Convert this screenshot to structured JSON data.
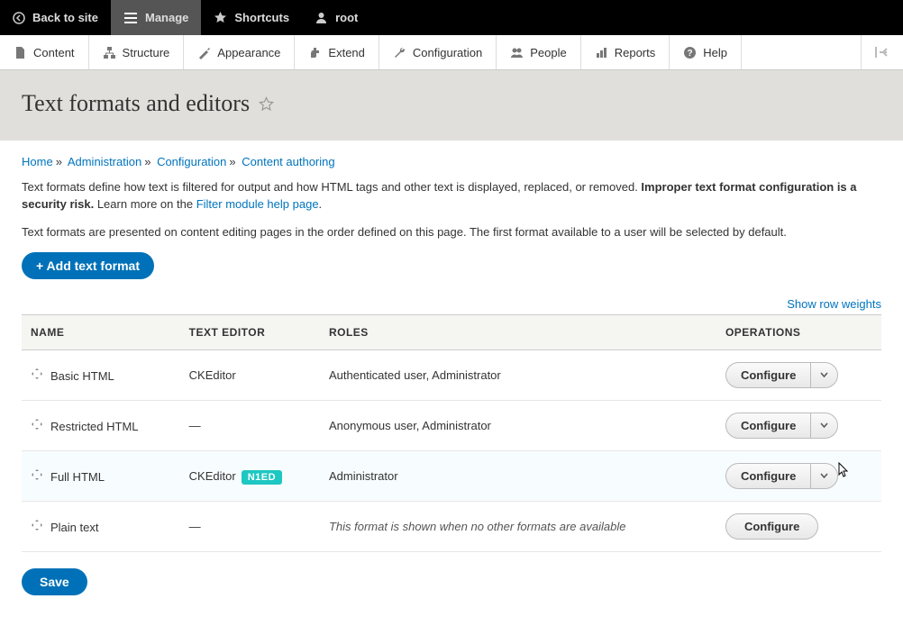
{
  "topbar": {
    "back": "Back to site",
    "manage": "Manage",
    "shortcuts": "Shortcuts",
    "user": "root"
  },
  "menubar": {
    "content": "Content",
    "structure": "Structure",
    "appearance": "Appearance",
    "extend": "Extend",
    "configuration": "Configuration",
    "people": "People",
    "reports": "Reports",
    "help": "Help"
  },
  "page_title": "Text formats and editors",
  "breadcrumb": {
    "home": "Home",
    "admin": "Administration",
    "config": "Configuration",
    "authoring": "Content authoring"
  },
  "desc": {
    "p1a": "Text formats define how text is filtered for output and how HTML tags and other text is displayed, replaced, or removed. ",
    "p1b": "Improper text format configuration is a security risk.",
    "p1c": " Learn more on the ",
    "p1link": "Filter module help page",
    "p1d": ".",
    "p2": "Text formats are presented on content editing pages in the order defined on this page. The first format available to a user will be selected by default."
  },
  "add_btn": "+ Add text format",
  "show_weights": "Show row weights",
  "columns": {
    "name": "Name",
    "editor": "Text Editor",
    "roles": "Roles",
    "ops": "Operations"
  },
  "rows": [
    {
      "name": "Basic HTML",
      "editor": "CKEditor",
      "badge": "",
      "roles": "Authenticated user, Administrator",
      "op": "Configure",
      "has_caret": true,
      "hover": false,
      "italic": false
    },
    {
      "name": "Restricted HTML",
      "editor": "—",
      "badge": "",
      "roles": "Anonymous user, Administrator",
      "op": "Configure",
      "has_caret": true,
      "hover": false,
      "italic": false
    },
    {
      "name": "Full HTML",
      "editor": "CKEditor",
      "badge": "N1ED",
      "roles": "Administrator",
      "op": "Configure",
      "has_caret": true,
      "hover": true,
      "italic": false
    },
    {
      "name": "Plain text",
      "editor": "—",
      "badge": "",
      "roles": "This format is shown when no other formats are available",
      "op": "Configure",
      "has_caret": false,
      "hover": false,
      "italic": true
    }
  ],
  "save": "Save"
}
